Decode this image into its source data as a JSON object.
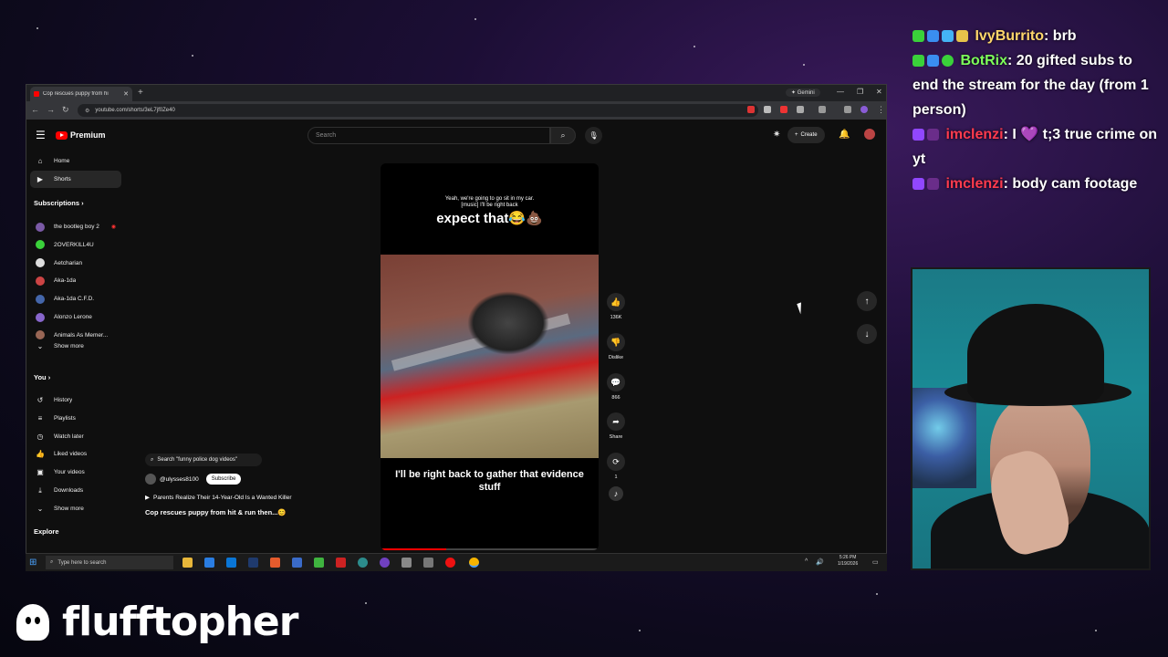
{
  "browser": {
    "tab_title": "Cop rescues puppy from hi",
    "gemini_label": "Gemini",
    "url": "youtube.com/shorts/3eL7jf0Ze40"
  },
  "youtube": {
    "brand": "Premium",
    "search_placeholder": "Search",
    "create_label": "Create",
    "sidebar": {
      "home": "Home",
      "shorts": "Shorts",
      "subscriptions_header": "Subscriptions",
      "subscriptions": [
        {
          "name": "the bootleg boy 2",
          "color": "#7b5aa6",
          "live": true
        },
        {
          "name": "2OVERKILL4U",
          "color": "#3ad13a",
          "live": false
        },
        {
          "name": "Aetcharian",
          "color": "#dddddd",
          "live": false
        },
        {
          "name": "Aka-1da",
          "color": "#c44",
          "live": false
        },
        {
          "name": "Aka-1da C.F.D.",
          "color": "#4466aa",
          "live": false
        },
        {
          "name": "Alonzo Lerone",
          "color": "#8866cc",
          "live": false
        },
        {
          "name": "Animals As Memer...",
          "color": "#996655",
          "live": false
        }
      ],
      "show_more": "Show more",
      "you_header": "You",
      "you_items": [
        "History",
        "Playlists",
        "Watch later",
        "Liked videos",
        "Your videos",
        "Downloads",
        "Show more"
      ],
      "explore_header": "Explore"
    },
    "short": {
      "caption_small_1": "Yeah, we're going to go sit in my car.",
      "caption_small_2": "[music] I'll be right back",
      "caption_big": "expect that😂💩",
      "bottom_caption": "I'll be right back to gather that evidence stuff",
      "progress": 0.3
    },
    "actions": {
      "likes": "136K",
      "dislike": "Dislike",
      "comments": "866",
      "share": "Share",
      "remix": "1"
    },
    "overlay": {
      "search_pill": "Search \"funny police dog videos\"",
      "channel": "@ulysses8100",
      "subscribe": "Subscribe",
      "related": "Parents Realize Their 14-Year-Old Is a Wanted Killer",
      "title": "Cop rescues puppy from hit & run then...😊"
    }
  },
  "taskbar": {
    "search_placeholder": "Type here to search",
    "time": "5:26 PM",
    "date": "1/19/2026"
  },
  "chat": [
    {
      "user": "IvyBurrito",
      "text": ": brb"
    },
    {
      "user": "BotRix",
      "text": ": 20 gifted subs to end the stream for the day (from 1 person)"
    },
    {
      "user": "imclenzi",
      "text": ": I 💜 t;3 true crime on yt"
    },
    {
      "user": "imclenzi",
      "text": ": body cam footage"
    }
  ],
  "streamer": {
    "name": "flufftopher"
  }
}
